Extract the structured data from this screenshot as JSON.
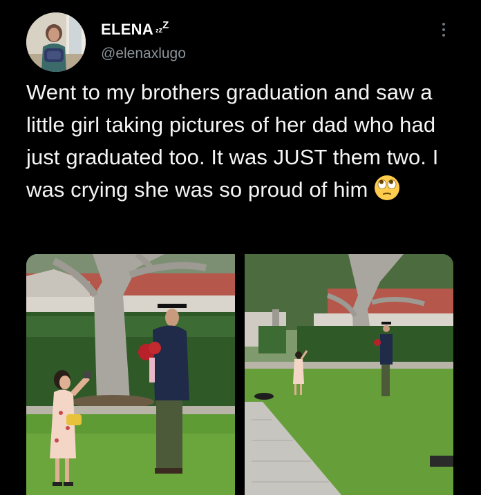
{
  "tweet": {
    "display_name": "ELENA",
    "name_suffix": [
      "z",
      "z",
      "Z"
    ],
    "handle": "@elenaxlugo",
    "text": "Went to my brothers graduation and saw a little girl taking pictures of her dad who had just graduated too. It was JUST them two. I was crying she was so proud of him",
    "emoji": "rolling-eyes-emoji"
  },
  "icons": {
    "more": "more-vertical-icon"
  },
  "media": [
    {
      "label": "photo-girl-photographing-graduate-closeup"
    },
    {
      "label": "photo-girl-photographing-graduate-wide"
    }
  ]
}
